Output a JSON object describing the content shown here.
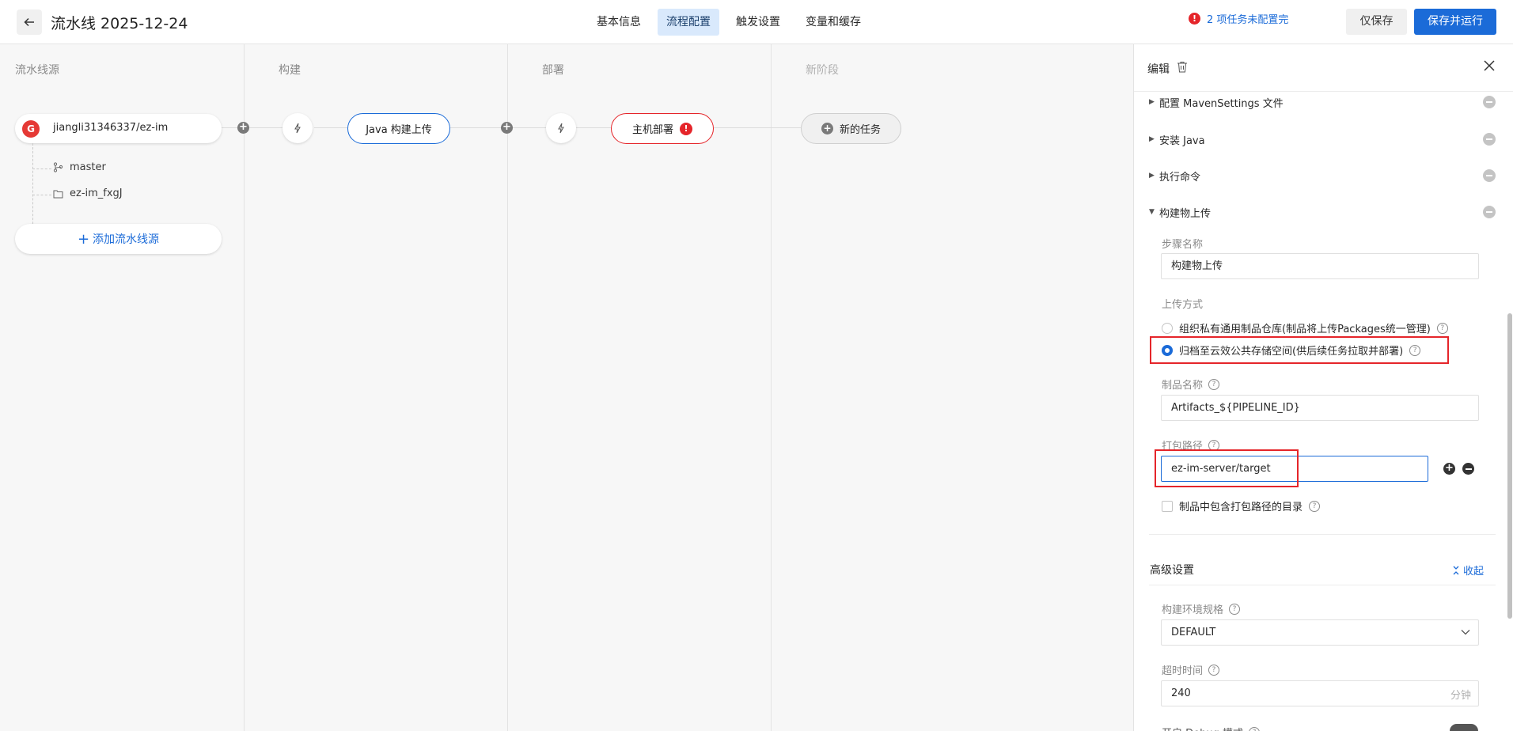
{
  "header": {
    "title": "流水线 2025-12-24",
    "tabs": [
      "基本信息",
      "流程配置",
      "触发设置",
      "变量和缓存"
    ],
    "active_tab": "流程配置",
    "warning": "2 项任务未配置完",
    "save_only": "仅保存",
    "save_run": "保存并运行"
  },
  "canvas": {
    "stages": [
      "流水线源",
      "构建",
      "部署",
      "新阶段"
    ],
    "source": {
      "repo": "jiangli31346337/ez-im",
      "branch": "master",
      "dir": "ez-im_fxgJ",
      "add_label": "添加流水线源"
    },
    "jobs": {
      "java": "Java 构建上传",
      "deploy": "主机部署",
      "new_task": "新的任务"
    }
  },
  "panel": {
    "title": "编辑",
    "steps": [
      "配置 MavenSettings 文件",
      "安装 Java",
      "执行命令",
      "构建物上传"
    ],
    "step_name_label": "步骤名称",
    "step_name_value": "构建物上传",
    "upload_mode_label": "上传方式",
    "upload_options": [
      "组织私有通用制品仓库(制品将上传Packages统一管理)",
      "归档至云效公共存储空间(供后续任务拉取并部署)"
    ],
    "artifact_name_label": "制品名称",
    "artifact_name_value": "Artifacts_${PIPELINE_ID}",
    "pack_path_label": "打包路径",
    "pack_path_value": "ez-im-server/target",
    "include_dir_label": "制品中包含打包路径的目录",
    "advanced_title": "高级设置",
    "collapse_label": "收起",
    "env_spec_label": "构建环境规格",
    "env_spec_value": "DEFAULT",
    "timeout_label": "超时时间",
    "timeout_value": "240",
    "timeout_unit": "分钟",
    "debug_label": "开启 Debug 模式"
  },
  "colors": {
    "primary": "#1b6bd8",
    "error": "#e5252a",
    "active_tab_bg": "#d9e9fc"
  }
}
